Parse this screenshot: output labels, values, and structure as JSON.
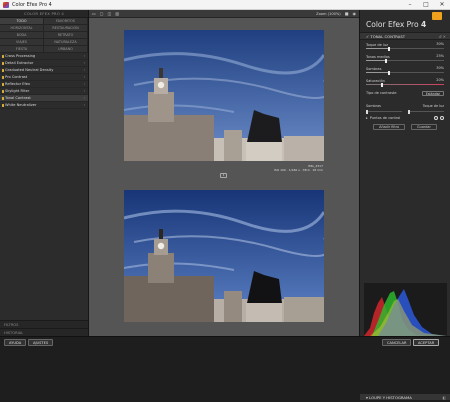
{
  "window": {
    "title": "Color Efex Pro 4"
  },
  "left_panel": {
    "header": "COLOR EFEX PRO 4",
    "categories": [
      "TODO",
      "FAVORITOS",
      "HORIZONTAL",
      "RESTAURACIÓN",
      "BODA",
      "RETRATO",
      "VIAJES",
      "NATURALEZA",
      "FIESTA",
      "URBANO"
    ],
    "filters": [
      {
        "name": "Cross Processing",
        "selected": false
      },
      {
        "name": "Detail Extractor",
        "selected": false
      },
      {
        "name": "Graduated Neutral Density",
        "selected": false
      },
      {
        "name": "Pro Contrast",
        "selected": false
      },
      {
        "name": "Reflector Efex",
        "selected": false
      },
      {
        "name": "Skylight Filter",
        "selected": false
      },
      {
        "name": "Tonal Contrast",
        "selected": true
      },
      {
        "name": "White Neutralizer",
        "selected": false
      }
    ],
    "bottom_items": [
      "FILTROS",
      "HISTORIAL"
    ]
  },
  "toolbar": {
    "zoom": "Zoom (100%)"
  },
  "preview": {
    "file_name": "IMG_4317",
    "file_meta": "ISO 100 · 1/160 s · f/8.0 · 18 mm"
  },
  "right_panel": {
    "brand_name": "Color Efex Pro",
    "brand_version": "4",
    "section_title": "TONAL CONTRAST",
    "sliders": [
      {
        "label": "Toque de luz",
        "value": "30%",
        "level": 0.3
      },
      {
        "label": "Tonos medios",
        "value": "25%",
        "level": 0.25
      },
      {
        "label": "Sombras",
        "value": "30%",
        "level": 0.3
      },
      {
        "label": "Saturación",
        "value": "20%",
        "level": 0.2
      }
    ],
    "contrast_type": {
      "label": "Tipo de contraste",
      "value": "Estándar"
    },
    "shadows_highlights": {
      "left": "Sombras",
      "right": "Toque de luz"
    },
    "control_points": {
      "label": "Puntos de control"
    },
    "buttons": {
      "add_filter": "Añadir filtro",
      "save": "Guardar"
    },
    "histogram_title": "LOUPE Y HISTOGRAMA"
  },
  "bottom_bar": {
    "help": "AYUDA",
    "settings": "AJUSTES",
    "cancel": "CANCELAR",
    "accept": "ACEPTAR"
  },
  "colors": {
    "accent": "#f0a11b",
    "sky": "#3a5fa5"
  }
}
